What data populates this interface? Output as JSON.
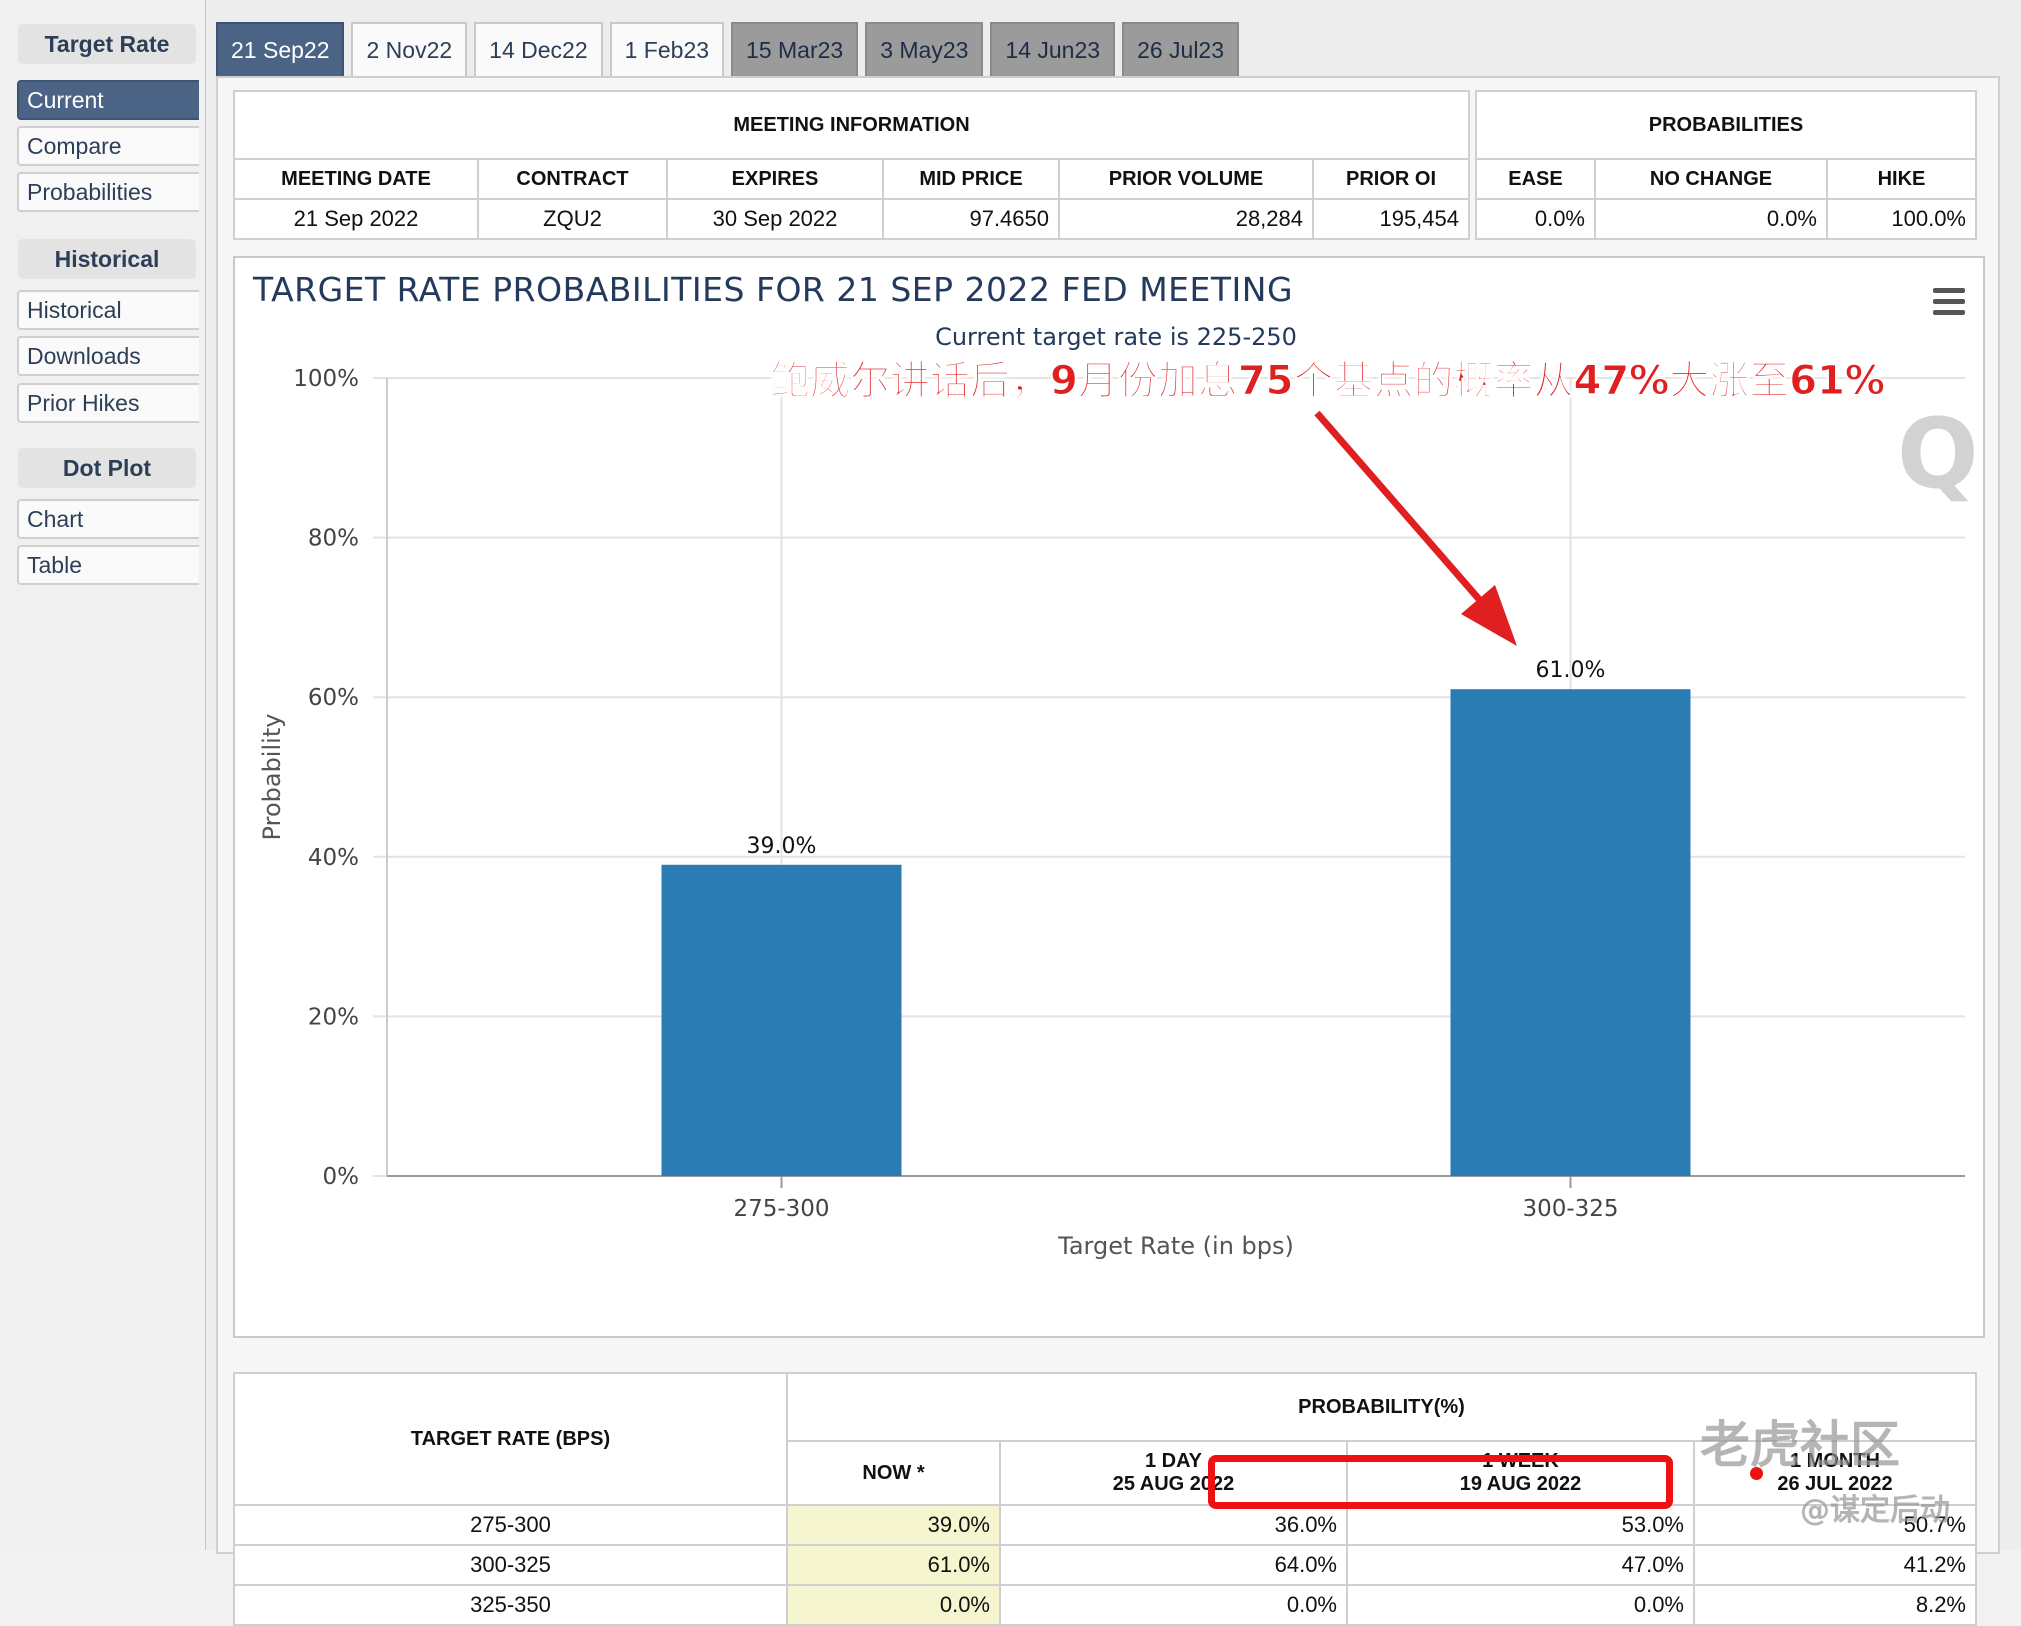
{
  "sidebar": {
    "sections": [
      {
        "title": "Target Rate",
        "items": [
          "Current",
          "Compare",
          "Probabilities"
        ]
      },
      {
        "title": "Historical",
        "items": [
          "Historical",
          "Downloads",
          "Prior Hikes"
        ]
      },
      {
        "title": "Dot Plot",
        "items": [
          "Chart",
          "Table"
        ]
      }
    ],
    "active_item": "Current"
  },
  "tabs": [
    {
      "label": "21 Sep22",
      "state": "active"
    },
    {
      "label": "2 Nov22",
      "state": "normal"
    },
    {
      "label": "14 Dec22",
      "state": "normal"
    },
    {
      "label": "1 Feb23",
      "state": "normal"
    },
    {
      "label": "15 Mar23",
      "state": "future"
    },
    {
      "label": "3 May23",
      "state": "future"
    },
    {
      "label": "14 Jun23",
      "state": "future"
    },
    {
      "label": "26 Jul23",
      "state": "future"
    }
  ],
  "meeting_info": {
    "header": "MEETING INFORMATION",
    "columns": [
      "MEETING DATE",
      "CONTRACT",
      "EXPIRES",
      "MID PRICE",
      "PRIOR VOLUME",
      "PRIOR OI"
    ],
    "row": [
      "21 Sep 2022",
      "ZQU2",
      "30 Sep 2022",
      "97.4650",
      "28,284",
      "195,454"
    ]
  },
  "probabilities": {
    "header": "PROBABILITIES",
    "columns": [
      "EASE",
      "NO CHANGE",
      "HIKE"
    ],
    "row": [
      "0.0%",
      "0.0%",
      "100.0%"
    ]
  },
  "chart_data": {
    "type": "bar",
    "title": "TARGET RATE PROBABILITIES FOR 21 SEP 2022 FED MEETING",
    "subtitle": "Current target rate is 225-250",
    "xlabel": "Target Rate (in bps)",
    "ylabel": "Probability",
    "categories": [
      "275-300",
      "300-325"
    ],
    "values": [
      39.0,
      61.0
    ],
    "data_labels": [
      "39.0%",
      "61.0%"
    ],
    "ylim": [
      0,
      100
    ],
    "yticks": [
      0,
      20,
      40,
      60,
      80,
      100
    ],
    "ytick_labels": [
      "0%",
      "20%",
      "40%",
      "60%",
      "80%",
      "100%"
    ],
    "grid": true,
    "bar_color": "#2b7bb5",
    "annotation": "鲍威尔讲话后，9月份加息75个基点的概率从47%大涨至61%",
    "annotation_color": "#e02020",
    "watermark": "Q"
  },
  "prob_table": {
    "target_header": "TARGET RATE (BPS)",
    "prob_header": "PROBABILITY(%)",
    "columns": [
      {
        "line1": "NOW *",
        "line2": ""
      },
      {
        "line1": "1 DAY",
        "line2": "25 AUG 2022"
      },
      {
        "line1": "1 WEEK",
        "line2": "19 AUG 2022"
      },
      {
        "line1": "1 MONTH",
        "line2": "26 JUL 2022"
      }
    ],
    "rows": [
      {
        "rate": "275-300",
        "values": [
          "39.0%",
          "36.0%",
          "53.0%",
          "50.7%"
        ]
      },
      {
        "rate": "300-325",
        "values": [
          "61.0%",
          "64.0%",
          "47.0%",
          "41.2%"
        ]
      },
      {
        "rate": "325-350",
        "values": [
          "0.0%",
          "0.0%",
          "0.0%",
          "8.2%"
        ]
      }
    ],
    "highlight_color": "#ee1111"
  },
  "watermarks": {
    "site": "老虎社区",
    "author": "@谋定后动"
  }
}
